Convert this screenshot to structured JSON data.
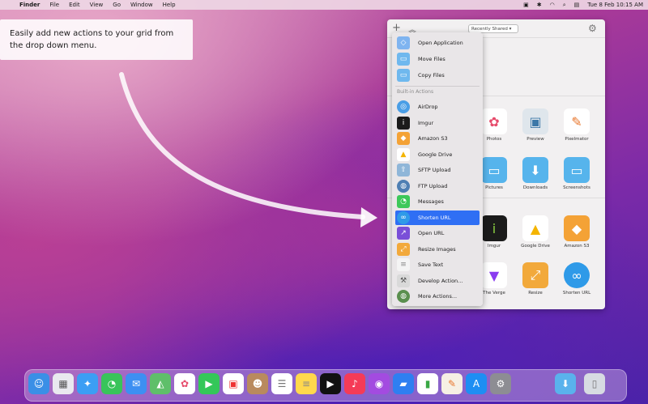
{
  "menubar": {
    "apple": "",
    "app": "Finder",
    "items": [
      "File",
      "Edit",
      "View",
      "Go",
      "Window",
      "Help"
    ],
    "clock": "Tue 8 Feb  10:15 AM"
  },
  "tooltip": {
    "text": "Easily add new actions to your grid from the drop down menu."
  },
  "panel": {
    "plus": "+",
    "chevron": "︽",
    "filter": "Recently Shared ▾",
    "gear": "⚙",
    "row1": [
      "Photos",
      "Preview",
      "Pixelmator"
    ],
    "row2": [
      "Pictures",
      "Downloads",
      "Screenshots"
    ],
    "row3": [
      "Imgur",
      "Google Drive",
      "Amazon S3"
    ],
    "row4": [
      "The Verge",
      "Resize",
      "Shorten URL"
    ]
  },
  "menu": {
    "top": [
      "Open Application",
      "Move Files",
      "Copy Files"
    ],
    "header": "Built-in Actions",
    "builtin": [
      "AirDrop",
      "Imgur",
      "Amazon S3",
      "Google Drive",
      "SFTP Upload",
      "FTP Upload",
      "Messages",
      "Shorten URL",
      "Open URL",
      "Resize Images",
      "Save Text",
      "Develop Action...",
      "More Actions..."
    ]
  },
  "colors": {
    "selection": "#2f6ff4",
    "accent_blue": "#4aa6e6"
  }
}
